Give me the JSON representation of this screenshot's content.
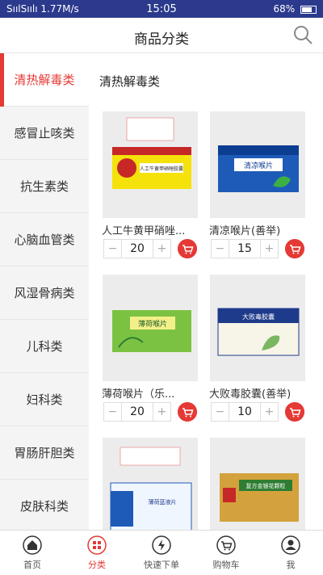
{
  "status_bar": {
    "signal": "SıılSıılı",
    "speed": "1.77M/s",
    "time": "15:05",
    "battery": "68%"
  },
  "header": {
    "title": "商品分类",
    "search_icon": "search-icon"
  },
  "sidebar": {
    "items": [
      {
        "label": "清热解毒类"
      },
      {
        "label": "感冒止咳类"
      },
      {
        "label": "抗生素类"
      },
      {
        "label": "心脑血管类"
      },
      {
        "label": "风湿骨病类"
      },
      {
        "label": "儿科类"
      },
      {
        "label": "妇科类"
      },
      {
        "label": "胃肠肝胆类"
      },
      {
        "label": "皮肤科类"
      }
    ]
  },
  "content": {
    "heading": "清热解毒类",
    "products": [
      {
        "name": "人工牛黄甲硝唑...",
        "qty": "20",
        "minus": "−",
        "plus": "+",
        "box_text": "人工牛黄甲硝唑胶囊"
      },
      {
        "name": "清凉喉片(善举)",
        "qty": "15",
        "minus": "−",
        "plus": "+",
        "box_text": "清凉喉片"
      },
      {
        "name": "薄荷喉片（乐...",
        "qty": "20",
        "minus": "−",
        "plus": "+",
        "box_text": "薄荷喉片"
      },
      {
        "name": "大败毒胶囊(善举)",
        "qty": "10",
        "minus": "−",
        "plus": "+",
        "box_text": "大败毒胶囊"
      },
      {
        "name": "",
        "qty": "",
        "minus": "",
        "plus": "",
        "box_text": "薄荷蓝液片"
      },
      {
        "name": "",
        "qty": "",
        "minus": "",
        "plus": "",
        "box_text": "复方金银花颗粒"
      }
    ]
  },
  "tabbar": {
    "items": [
      {
        "label": "首页",
        "icon": "home-icon"
      },
      {
        "label": "分类",
        "icon": "category-icon"
      },
      {
        "label": "快速下单",
        "icon": "lightning-icon"
      },
      {
        "label": "购物车",
        "icon": "cart-icon"
      },
      {
        "label": "我",
        "icon": "profile-icon"
      }
    ]
  },
  "colors": {
    "accent": "#e53935",
    "status_bar": "#2b3a8c"
  }
}
